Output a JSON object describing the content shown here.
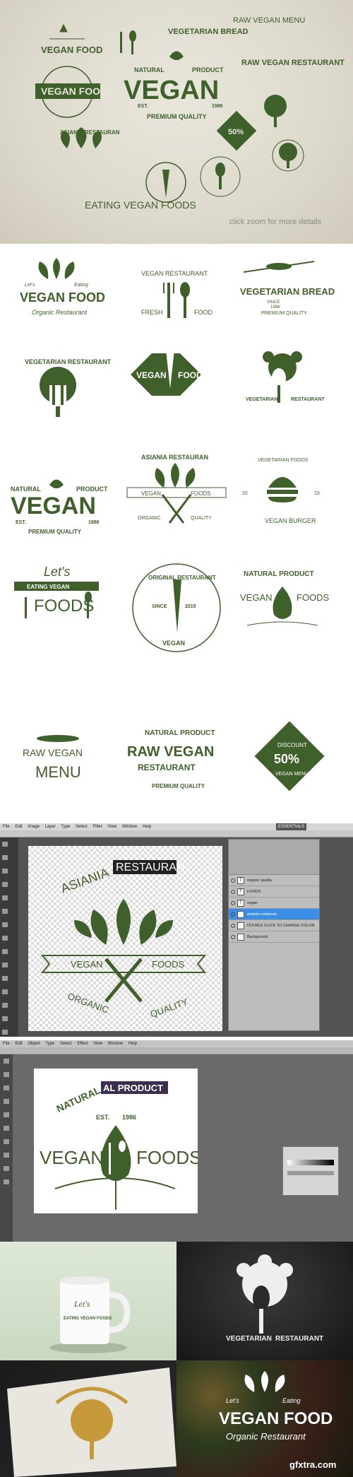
{
  "hero": {
    "caption": "click zoom for more details",
    "center": {
      "natural": "NATURAL",
      "product": "PRODUCT",
      "title": "VEGAN",
      "est": "EST.",
      "year": "1986",
      "quality": "PREMIUM QUALITY"
    },
    "badges": {
      "vegan_food2": "VEGAN FOOD",
      "vegan_foods": "VEGAN FOODS",
      "vegetarian_bread": "VEGETARIAN BREAD",
      "raw_vegan_menu": "RAW VEGAN MENU",
      "raw_vegan_restaurant": "RAW VEGAN RESTAURANT",
      "asiania": "ASIANIA RESTAURAN",
      "eating": "EATING VEGAN FOODS",
      "discount": "50%"
    }
  },
  "grid": {
    "l1": {
      "lets": "Let's",
      "eating": "Eating",
      "title": "VEGAN FOOD",
      "sub": "Organic Restaurant"
    },
    "l2": {
      "top": "VEGAN RESTAURANT",
      "fresh": "FRESH",
      "food": "FOOD"
    },
    "l3": {
      "title": "VEGETARIAN BREAD",
      "since": "SINCE",
      "year": "1986",
      "quality": "PREMIUM QUALITY"
    },
    "l4": {
      "title": "VEGETARIAN RESTAURANT"
    },
    "l5": {
      "vegan": "VEGAN",
      "foods": "FOODS"
    },
    "l6": {
      "veg": "VEGETARIAN",
      "rest": "RESTAURANT"
    },
    "l7": {
      "natural": "NATURAL",
      "product": "PRODUCT",
      "title": "VEGAN",
      "est": "EST.",
      "year": "1986",
      "quality": "PREMIUM QUALITY"
    },
    "l8": {
      "top": "ASIANIA RESTAURAN",
      "vegan": "VEGAN",
      "foods": "FOODS",
      "organic": "ORGANIC",
      "quality": "QUALITY"
    },
    "l9": {
      "top": "VEGETARIAN FOODS",
      "n1": "20",
      "n2": "15",
      "bottom": "VEGAN BURGER"
    },
    "l10": {
      "lets": "Let's",
      "eating": "EATING VEGAN",
      "foods": "FOODS"
    },
    "l11": {
      "top": "ORIGINAL RESTAURANT",
      "since": "SINCE",
      "year": "2015",
      "vegan": "VEGAN"
    },
    "l12": {
      "natural": "NATURAL PRODUCT",
      "vegan": "VEGAN",
      "foods": "FOODS"
    },
    "l13": {
      "raw": "RAW VEGAN",
      "menu": "MENU"
    },
    "l14": {
      "natural": "NATURAL PRODUCT",
      "title": "RAW VEGAN",
      "rest": "RESTAURANT",
      "quality": "PREMIUM QUALITY"
    },
    "l15": {
      "pct": "50%",
      "disc": "DISCOUNT",
      "menu": "VEGAN MENU"
    }
  },
  "ps": {
    "menu": [
      "File",
      "Edit",
      "Image",
      "Layer",
      "Type",
      "Select",
      "Filter",
      "View",
      "Window",
      "Help"
    ],
    "workspace": "ESSENTIALS",
    "layers": [
      {
        "t": "T",
        "name": "organic quality"
      },
      {
        "t": "T",
        "name": "FOODS"
      },
      {
        "t": "T",
        "name": "vegan"
      },
      {
        "t": "T",
        "name": "asiania restauran",
        "sel": true
      },
      {
        "t": "",
        "name": "DOUBLE CLICK TO CHANGE COLOR"
      },
      {
        "t": "",
        "name": "Background"
      }
    ],
    "canvas": {
      "top": "ASIANIA",
      "ribbon": "RESTAURAN",
      "vegan": "VEGAN",
      "foods": "FOODS",
      "organic": "ORGANIC",
      "quality": "QUALITY"
    }
  },
  "ai": {
    "menu": [
      "File",
      "Edit",
      "Object",
      "Type",
      "Select",
      "Effect",
      "View",
      "Window",
      "Help"
    ],
    "canvas": {
      "natural": "NATURAL",
      "product": "AL PRODUCT",
      "est": "EST.",
      "year": "1986",
      "vegan": "VEGAN",
      "foods": "FOODS"
    }
  },
  "mock": {
    "mug_lets": "Let's",
    "mug_text": "EATING VEGAN FOODS",
    "chalk_veg": "VEGETARIAN",
    "chalk_rest": "RESTAURANT",
    "photo_lets": "Let's",
    "photo_eating": "Eating",
    "photo_title": "VEGAN FOOD",
    "photo_sub": "Organic Restaurant",
    "watermark": "gfxtra.com"
  }
}
